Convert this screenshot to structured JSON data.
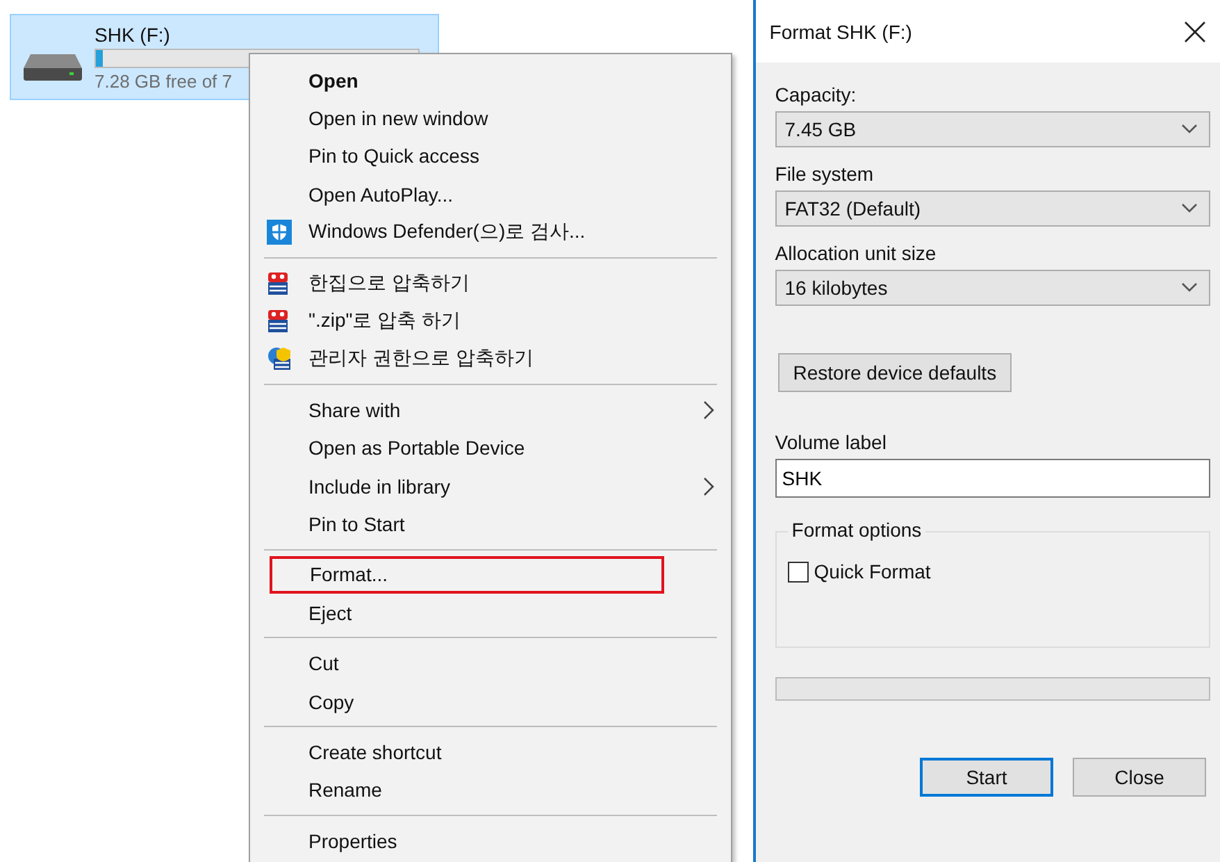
{
  "drive": {
    "name": "SHK (F:)",
    "level": 0.02,
    "free_text": "7.28 GB free of 7",
    "selected": true
  },
  "context_menu": {
    "items": [
      {
        "kind": "item",
        "label": "Open",
        "bold": true
      },
      {
        "kind": "item",
        "label": "Open in new window"
      },
      {
        "kind": "item",
        "label": "Pin to Quick access"
      },
      {
        "kind": "item",
        "label": "Open AutoPlay..."
      },
      {
        "kind": "defender",
        "label": "Windows Defender(으)로 검사..."
      },
      {
        "kind": "separator"
      },
      {
        "kind": "archive",
        "label": "한집으로 압축하기"
      },
      {
        "kind": "archive",
        "label": "\".zip\"로 압축 하기"
      },
      {
        "kind": "admin",
        "label": "관리자 권한으로 압축하기"
      },
      {
        "kind": "separator"
      },
      {
        "kind": "item",
        "label": "Share with",
        "submenu": true
      },
      {
        "kind": "item",
        "label": "Open as Portable Device"
      },
      {
        "kind": "item",
        "label": "Include in library",
        "submenu": true
      },
      {
        "kind": "item",
        "label": "Pin to Start"
      },
      {
        "kind": "separator"
      },
      {
        "kind": "item",
        "label": "Format...",
        "highlighted": true
      },
      {
        "kind": "item",
        "label": "Eject"
      },
      {
        "kind": "separator"
      },
      {
        "kind": "item",
        "label": "Cut"
      },
      {
        "kind": "item",
        "label": "Copy"
      },
      {
        "kind": "separator"
      },
      {
        "kind": "item",
        "label": "Create shortcut"
      },
      {
        "kind": "item",
        "label": "Rename"
      },
      {
        "kind": "separator"
      },
      {
        "kind": "item",
        "label": "Properties"
      }
    ]
  },
  "dialog": {
    "title": "Format SHK (F:)",
    "fields": [
      {
        "label": "Capacity:",
        "value": "7.45 GB"
      },
      {
        "label": "File system",
        "value": "FAT32 (Default)"
      },
      {
        "label": "Allocation unit size",
        "value": "16 kilobytes"
      }
    ],
    "restore_button": "Restore device defaults",
    "volume_label": {
      "label": "Volume label",
      "value": "SHK"
    },
    "format_options": {
      "title": "Format options",
      "quick_format": {
        "label": "Quick Format",
        "checked": false
      }
    },
    "progress": {
      "level": 0
    },
    "buttons": [
      {
        "label": "Start",
        "default": true
      },
      {
        "label": "Close",
        "default": false
      }
    ]
  }
}
